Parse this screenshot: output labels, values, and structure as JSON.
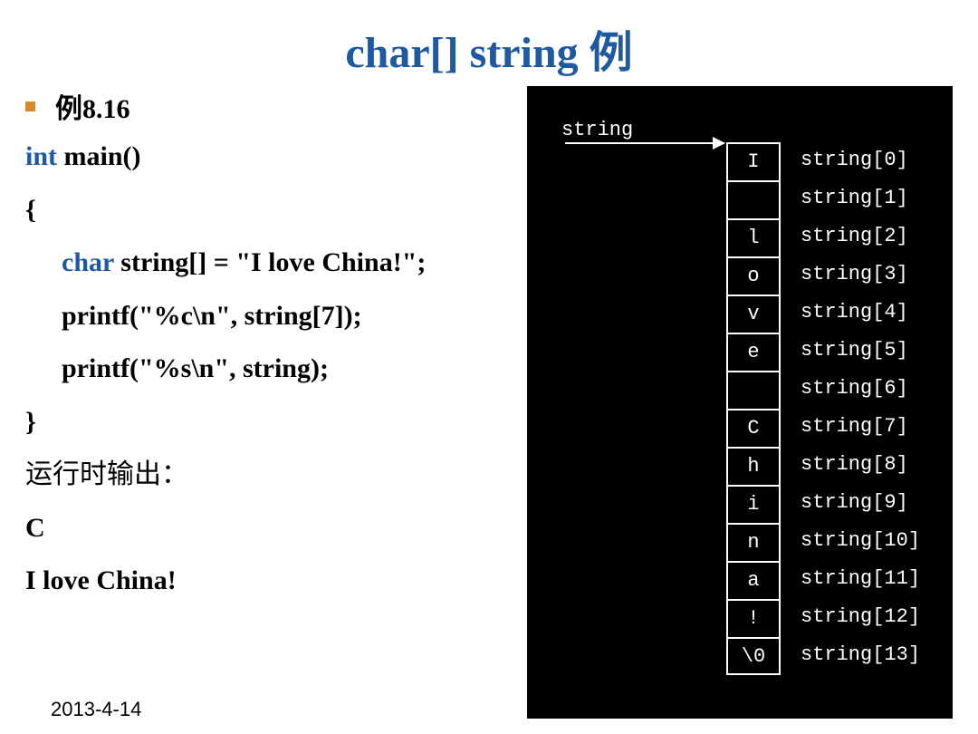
{
  "title": "char[] string 例",
  "example_label": "例8.16",
  "code": {
    "line1_kw": "int",
    "line1_rest": " main()",
    "brace_open": "{",
    "line2_kw": "char",
    "line2_rest": " string[] = \"I love China!\";",
    "line3": "printf(\"%c\\n\", string[7]);",
    "line4": "printf(\"%s\\n\", string);",
    "brace_close": "}"
  },
  "output": {
    "label": "运行时输出：",
    "line1": "C",
    "line2": "I love China!"
  },
  "footer_date": "2013-4-14",
  "diagram": {
    "var_label": "string",
    "cells": [
      "I",
      " ",
      "l",
      "o",
      "v",
      "e",
      " ",
      "C",
      "h",
      "i",
      "n",
      "a",
      "!",
      "\\0"
    ],
    "labels": [
      "string[0]",
      "string[1]",
      "string[2]",
      "string[3]",
      "string[4]",
      "string[5]",
      "string[6]",
      "string[7]",
      "string[8]",
      "string[9]",
      "string[10]",
      "string[11]",
      "string[12]",
      "string[13]"
    ]
  }
}
